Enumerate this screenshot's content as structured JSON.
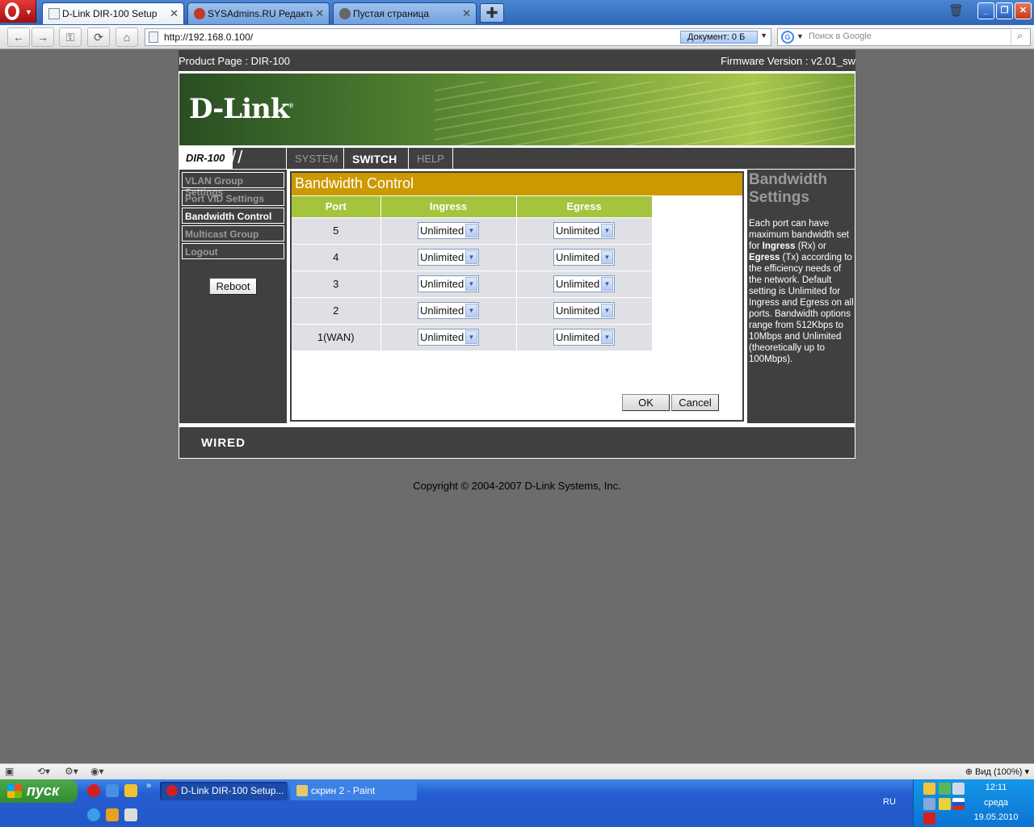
{
  "browser": {
    "tabs": [
      {
        "label": "D-Link DIR-100 Setup",
        "active": true
      },
      {
        "label": "SYSAdmins.RU Редакти...",
        "active": false
      },
      {
        "label": "Пустая страница",
        "active": false
      }
    ],
    "address": "http://192.168.0.100/",
    "doc_indicator": "Документ:   0 Б",
    "search_placeholder": "Поиск в Google",
    "zoom": "Вид (100%)"
  },
  "router": {
    "product_page": "Product Page : DIR-100",
    "firmware": "Firmware Version : v2.01_sw",
    "logo": "D-Link",
    "model": "DIR-100",
    "nav_tabs": [
      {
        "label": "SYSTEM",
        "selected": false
      },
      {
        "label": "SWITCH",
        "selected": true
      },
      {
        "label": "HELP",
        "selected": false
      }
    ],
    "menu": [
      {
        "label": "VLAN Group Settings",
        "selected": false
      },
      {
        "label": "Port VID Settings",
        "selected": false
      },
      {
        "label": "Bandwidth Control",
        "selected": true
      },
      {
        "label": "Multicast Group",
        "selected": false
      },
      {
        "label": "Logout",
        "selected": false
      }
    ],
    "reboot_label": "Reboot",
    "content_title": "Bandwidth Control",
    "table_headers": [
      "Port",
      "Ingress",
      "Egress"
    ],
    "rows": [
      {
        "port": "5",
        "ingress": "Unlimited",
        "egress": "Unlimited"
      },
      {
        "port": "4",
        "ingress": "Unlimited",
        "egress": "Unlimited"
      },
      {
        "port": "3",
        "ingress": "Unlimited",
        "egress": "Unlimited"
      },
      {
        "port": "2",
        "ingress": "Unlimited",
        "egress": "Unlimited"
      },
      {
        "port": "1(WAN)",
        "ingress": "Unlimited",
        "egress": "Unlimited"
      }
    ],
    "ok_label": "OK",
    "cancel_label": "Cancel",
    "help": {
      "title": "Bandwidth Settings",
      "p1": "Each port can have maximum bandwidth set for ",
      "b1": "Ingress",
      "p2": " (Rx) or ",
      "b2": "Egress",
      "p3": " (Tx) according to the efficiency needs of the network. Default setting is Unlimited for Ingress and Egress on all ports. Bandwidth options range from 512Kbps to 10Mbps and Unlimited (theoretically up to 100Mbps)."
    },
    "footer_brand": "WIRED",
    "copyright": "Copyright © 2004-2007 D-Link Systems, Inc."
  },
  "taskbar": {
    "start_label": "пуск",
    "tasks": [
      {
        "label": "D-Link DIR-100 Setup...",
        "active": true
      },
      {
        "label": "скрин 2 - Paint",
        "active": false
      }
    ],
    "lang": "RU",
    "time": "12:11",
    "day": "среда",
    "date": "19.05.2010"
  },
  "colors": {
    "accent_title": "#cc9900",
    "table_header": "#a3c43c",
    "panel": "#404040"
  }
}
